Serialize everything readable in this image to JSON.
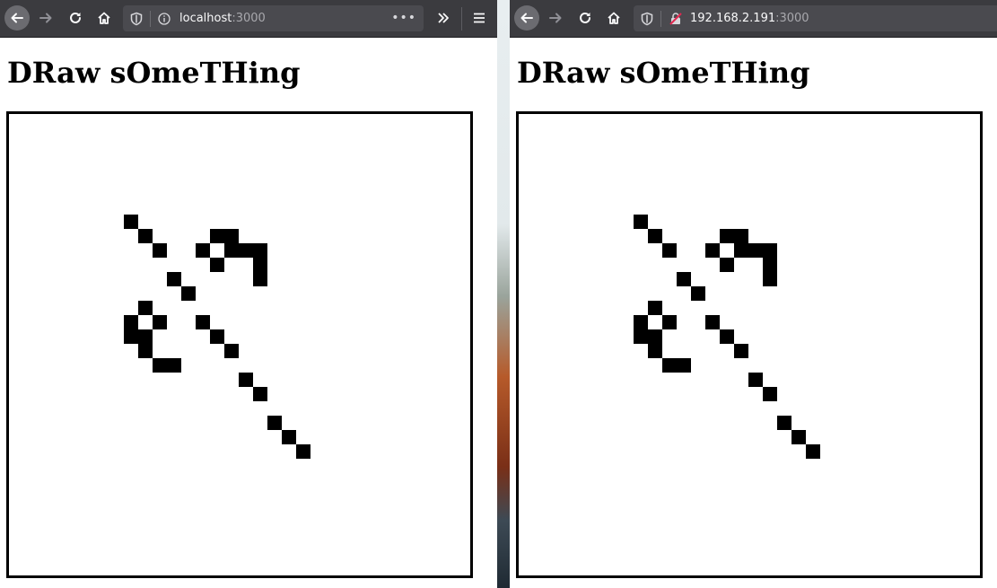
{
  "windows": [
    {
      "id": "left",
      "url_host": "localhost",
      "url_port": ":3000",
      "page_title": "DRaw sOmeTHing"
    },
    {
      "id": "right",
      "url_host": "192.168.2.191",
      "url_port": ":3000",
      "page_title": "DRaw sOmeTHing"
    }
  ],
  "drawing": {
    "grid_cells": 32,
    "filled_cells": [
      [
        8,
        7
      ],
      [
        9,
        8
      ],
      [
        10,
        9
      ],
      [
        14,
        8
      ],
      [
        15,
        8
      ],
      [
        13,
        9
      ],
      [
        15,
        9
      ],
      [
        16,
        9
      ],
      [
        17,
        9
      ],
      [
        14,
        10
      ],
      [
        17,
        10
      ],
      [
        17,
        11
      ],
      [
        11,
        11
      ],
      [
        12,
        12
      ],
      [
        9,
        13
      ],
      [
        8,
        14
      ],
      [
        10,
        14
      ],
      [
        13,
        14
      ],
      [
        8,
        15
      ],
      [
        9,
        15
      ],
      [
        14,
        15
      ],
      [
        9,
        16
      ],
      [
        15,
        16
      ],
      [
        10,
        17
      ],
      [
        11,
        17
      ],
      [
        16,
        18
      ],
      [
        17,
        19
      ],
      [
        18,
        21
      ],
      [
        19,
        22
      ],
      [
        20,
        23
      ]
    ]
  },
  "colors": {
    "toolbar": "#3b3b3f",
    "urlbar": "#4a4a4f",
    "pixel": "#000000",
    "canvas_bg": "#ffffff"
  }
}
